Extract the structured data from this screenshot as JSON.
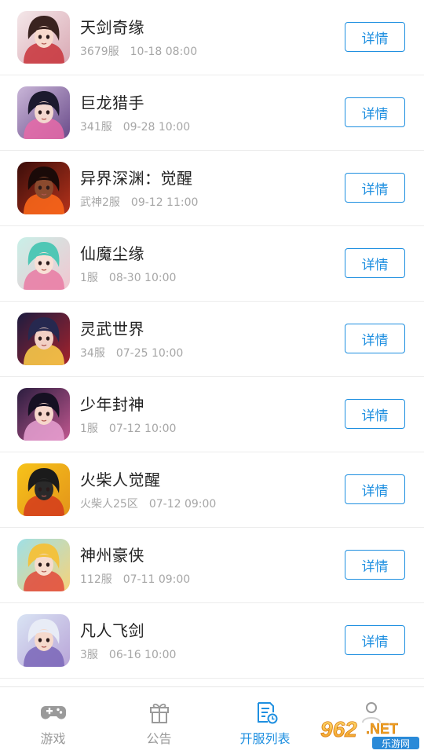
{
  "games": [
    {
      "title": "天剑奇缘",
      "server": "3679服",
      "time": "10-18 08:00",
      "button": "详情",
      "art": "a"
    },
    {
      "title": "巨龙猎手",
      "server": "341服",
      "time": "09-28 10:00",
      "button": "详情",
      "art": "b"
    },
    {
      "title": "异界深渊：觉醒",
      "server": "武神2服",
      "time": "09-12 11:00",
      "button": "详情",
      "art": "c"
    },
    {
      "title": "仙魔尘缘",
      "server": "1服",
      "time": "08-30 10:00",
      "button": "详情",
      "art": "d"
    },
    {
      "title": "灵武世界",
      "server": "34服",
      "time": "07-25 10:00",
      "button": "详情",
      "art": "e"
    },
    {
      "title": "少年封神",
      "server": "1服",
      "time": "07-12 10:00",
      "button": "详情",
      "art": "f"
    },
    {
      "title": "火柴人觉醒",
      "server": "火柴人25区",
      "time": "07-12 09:00",
      "button": "详情",
      "art": "g"
    },
    {
      "title": "神州豪侠",
      "server": "112服",
      "time": "07-11 09:00",
      "button": "详情",
      "art": "h"
    },
    {
      "title": "凡人飞剑",
      "server": "3服",
      "time": "06-16 10:00",
      "button": "详情",
      "art": "i"
    }
  ],
  "tabbar": {
    "tabs": [
      {
        "label": "游戏",
        "icon": "gamepad-icon",
        "active": false
      },
      {
        "label": "公告",
        "icon": "gift-icon",
        "active": false
      },
      {
        "label": "开服列表",
        "icon": "server-list-icon",
        "active": true
      },
      {
        "label": "",
        "icon": "user-icon",
        "active": false
      }
    ]
  },
  "watermark": {
    "number": "962",
    "suffix": ".NET",
    "site": "乐游网"
  },
  "colors": {
    "accent": "#1e8fe0",
    "muted": "#a6a6a6",
    "text": "#222222",
    "divider": "#ececec"
  }
}
